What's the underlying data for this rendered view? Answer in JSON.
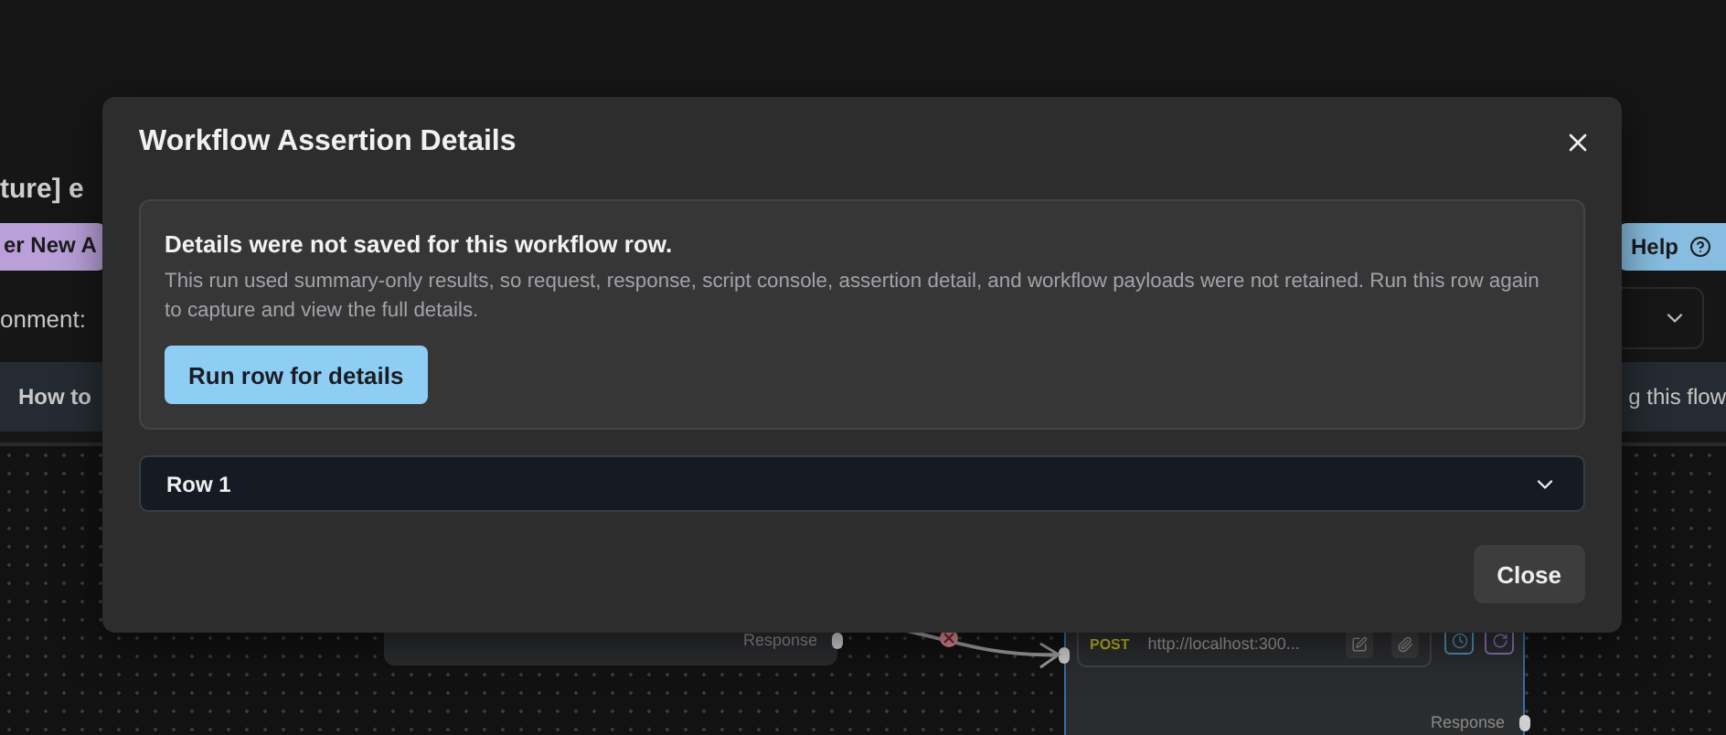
{
  "background": {
    "title": "ture] e",
    "left_button": "er New A",
    "help_button": "Help",
    "environment_label": "onment:",
    "banner_left": "How to",
    "banner_right": "g this flow",
    "nodes": [
      {
        "kind": "plain",
        "selected": false,
        "handle_label": "Response"
      },
      {
        "kind": "request",
        "selected": true,
        "method": "POST",
        "url": "http://localhost:300...",
        "handle_label": "Response"
      }
    ]
  },
  "dialog": {
    "title": "Workflow Assertion Details",
    "notice": {
      "heading": "Details were not saved for this workflow row.",
      "body": "This run used summary-only results, so request, response, script console, assertion detail, and workflow payloads were not retained. Run this row again to capture and view the full details.",
      "action": "Run row for details"
    },
    "rows": [
      {
        "label": "Row 1",
        "expanded": false
      }
    ],
    "close_button": "Close"
  }
}
